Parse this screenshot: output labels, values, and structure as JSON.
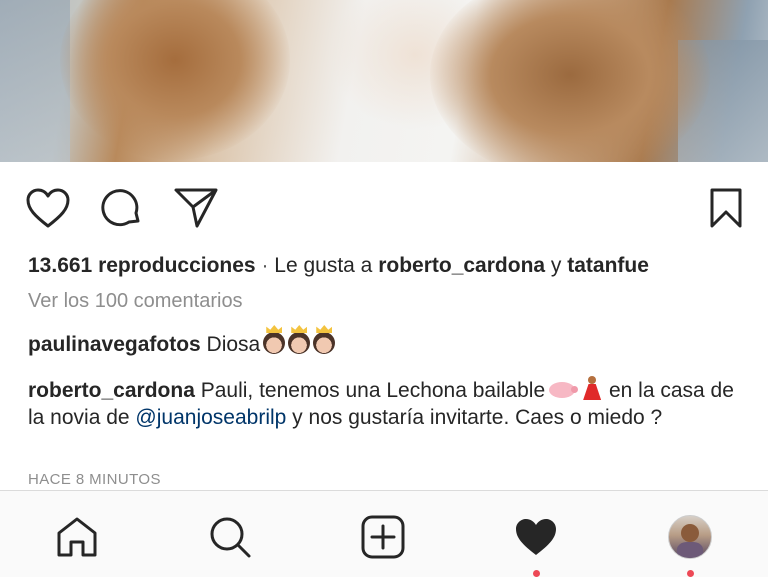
{
  "post": {
    "views_count": "13.661 reproducciones",
    "separator": " · ",
    "liked_by_prefix": "Le gusta a ",
    "liked_user_1": "roberto_cardona",
    "liked_joiner": " y ",
    "liked_user_2": "tatanfue",
    "view_comments": "Ver los 100 comentarios",
    "timestamp": "HACE 8 MINUTOS"
  },
  "comments": [
    {
      "user": "paulinavegafotos",
      "text": "Diosa"
    },
    {
      "user": "roberto_cardona",
      "text_part1": "Pauli, tenemos una Lechona bailable",
      "text_part2": " en la casa de la novia de ",
      "mention": "@juanjoseabrilp",
      "text_part3": " y nos gustaría invitarte. Caes o miedo ?"
    }
  ],
  "icons": {
    "actions": [
      "heart-icon",
      "comment-icon",
      "share-icon",
      "bookmark-icon"
    ],
    "nav": [
      "home-icon",
      "search-icon",
      "add-post-icon",
      "activity-heart-icon",
      "profile-avatar"
    ]
  },
  "colors": {
    "text": "#262626",
    "secondary": "#8e8e8e",
    "mention": "#003569",
    "notification_dot": "#ed4956"
  }
}
